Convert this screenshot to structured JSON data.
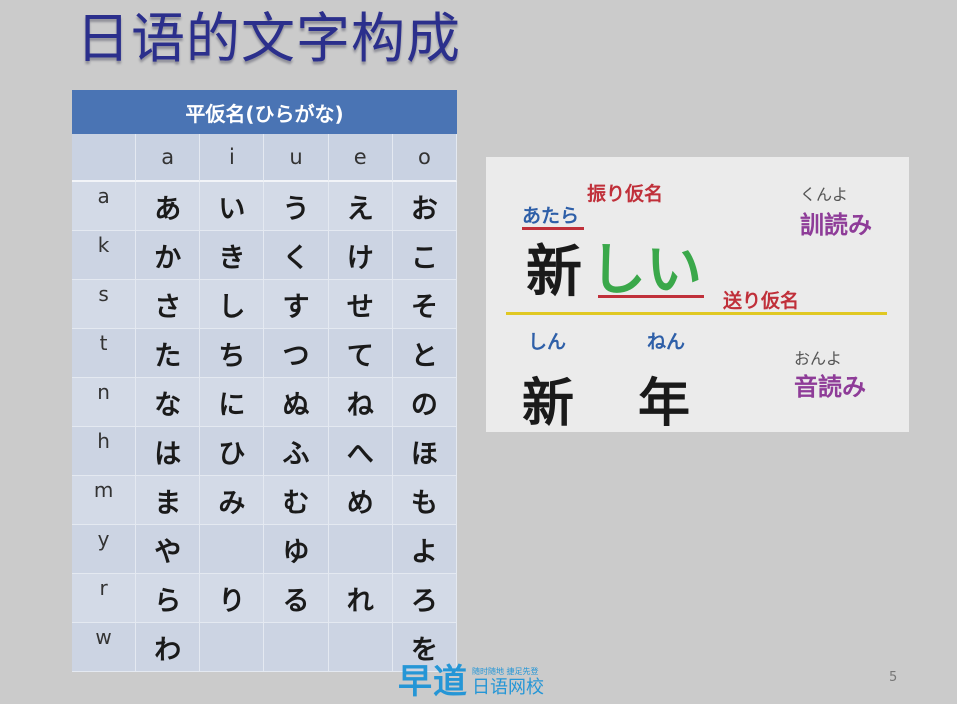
{
  "slide": {
    "title": "日语的文字构成",
    "page_number": "5"
  },
  "kana_table": {
    "header": "平仮名(ひらがな)",
    "vowels": [
      "",
      "a",
      "i",
      "u",
      "e",
      "o"
    ],
    "rows": [
      [
        "a",
        "あ",
        "い",
        "う",
        "え",
        "お"
      ],
      [
        "k",
        "か",
        "き",
        "く",
        "け",
        "こ"
      ],
      [
        "s",
        "さ",
        "し",
        "す",
        "せ",
        "そ"
      ],
      [
        "t",
        "た",
        "ち",
        "つ",
        "て",
        "と"
      ],
      [
        "n",
        "な",
        "に",
        "ぬ",
        "ね",
        "の"
      ],
      [
        "h",
        "は",
        "ひ",
        "ふ",
        "へ",
        "ほ"
      ],
      [
        "m",
        "ま",
        "み",
        "む",
        "め",
        "も"
      ],
      [
        "y",
        "や",
        "",
        "ゆ",
        "",
        "よ"
      ],
      [
        "r",
        "ら",
        "り",
        "る",
        "れ",
        "ろ"
      ],
      [
        "w",
        "わ",
        "",
        "",
        "",
        "を"
      ]
    ]
  },
  "reading_panel": {
    "furigana_label": "振り仮名",
    "kun_example": {
      "furigana": "あたら",
      "kanji": "新",
      "okurigana": "しい"
    },
    "okurigana_label": "送り仮名",
    "kunyomi": {
      "reading": "くんよ",
      "label": "訓読み"
    },
    "on_example": {
      "shin_reading": "しん",
      "nen_reading": "ねん",
      "shin_kanji": "新",
      "nen_kanji": "年"
    },
    "onyomi": {
      "reading": "おんよ",
      "label": "音読み"
    },
    "colors": {
      "furigana_red": "#c0303a",
      "reading_blue": "#2e5fa8",
      "okurigana_green": "#3aa84a",
      "label_purple": "#8e3c98",
      "divider_yellow": "#e0c823"
    }
  },
  "footer": {
    "logo_main": "早道",
    "logo_slogan": "随时随地 捷足先登",
    "logo_sub": "日语网校"
  }
}
